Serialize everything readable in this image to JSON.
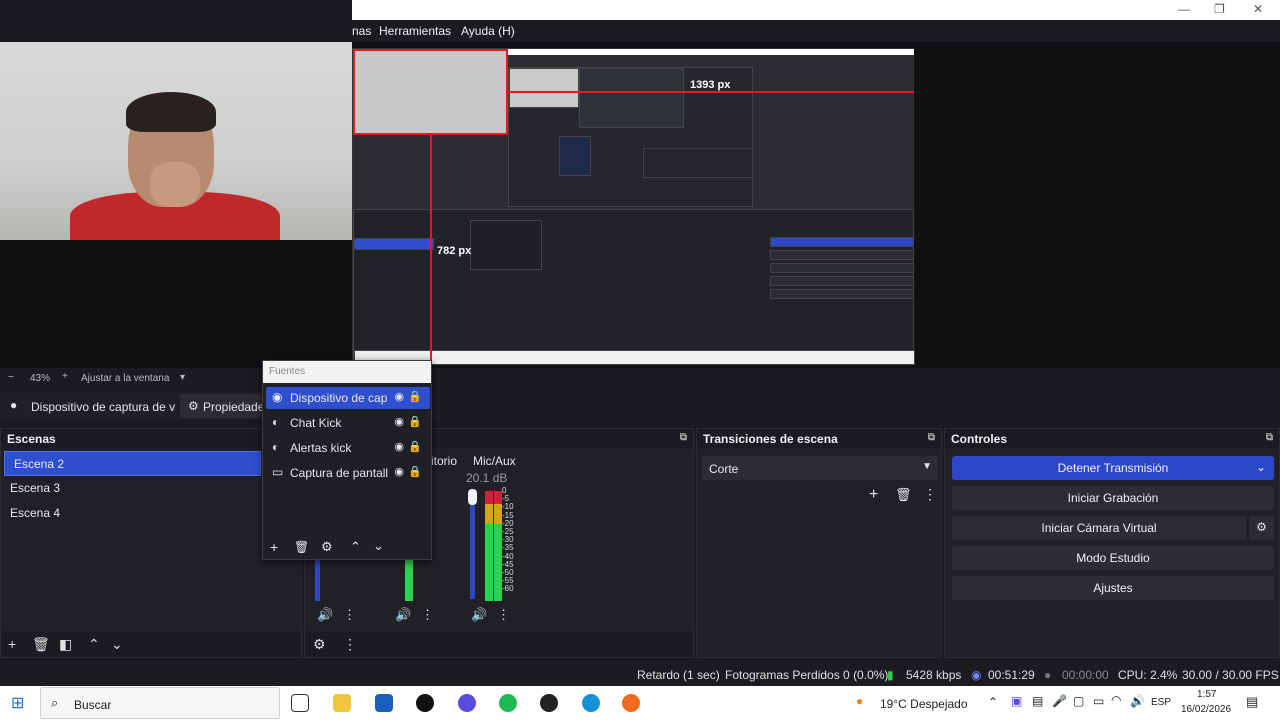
{
  "window": {
    "menus": [
      "nas",
      "Herramientas",
      "Ayuda (H)"
    ],
    "minimize": "—",
    "restore": "❐",
    "close": "✕"
  },
  "preview": {
    "dimension_width_label": "1393 px",
    "dimension_height_label": "782 px"
  },
  "zoombar": {
    "minus": "−",
    "zoom": "43%",
    "plus": "+",
    "fit": "Ajustar a la ventana"
  },
  "source_toolbar": {
    "source_name": "Dispositivo de captura de v",
    "properties_label": "Propiedade"
  },
  "fuentes": {
    "title": "Fuentes",
    "items": [
      {
        "label": "Dispositivo de cap",
        "icon": "camera-icon",
        "selected": true
      },
      {
        "label": "Chat Kick",
        "icon": "browser-icon",
        "selected": false
      },
      {
        "label": "Alertas kick",
        "icon": "browser-icon",
        "selected": false
      },
      {
        "label": "Captura de pantall",
        "icon": "monitor-icon",
        "selected": false
      }
    ]
  },
  "scenes": {
    "title": "Escenas",
    "items": [
      {
        "label": "Escena 2",
        "selected": true
      },
      {
        "label": "Escena 3",
        "selected": false
      },
      {
        "label": "Escena 4",
        "selected": false
      }
    ]
  },
  "mixer": {
    "partial_label": "itorio",
    "mic_label": "Mic/Aux",
    "mic_db": "20.1 dB",
    "scale": [
      "0",
      "-5",
      "-10",
      "-15",
      "-20",
      "-25",
      "-30",
      "-35",
      "-40",
      "-45",
      "-50",
      "-55",
      "-60"
    ]
  },
  "transitions": {
    "title": "Transiciones de escena",
    "selected": "Corte"
  },
  "controls": {
    "title": "Controles",
    "stop_stream": "Detener Transmisión",
    "start_recording": "Iniciar Grabación",
    "virtual_camera": "Iniciar Cámara Virtual",
    "studio_mode": "Modo Estudio",
    "settings": "Ajustes"
  },
  "status": {
    "delay": "Retardo (1 sec)",
    "dropped": "Fotogramas Perdidos 0 (0.0%)",
    "bitrate": "5428 kbps",
    "stream_time": "00:51:29",
    "rec_time": "00:00:00",
    "cpu": "CPU: 2.4%",
    "fps": "30.00 / 30.00 FPS"
  },
  "taskbar": {
    "search_placeholder": "Buscar",
    "weather": "19°C  Despejado",
    "language": "ESP",
    "time": "1:57",
    "date": "16/02/2026"
  },
  "colors": {
    "accent": "#2c47c7",
    "selection": "#2f4fcf",
    "guide": "#e01b24"
  }
}
